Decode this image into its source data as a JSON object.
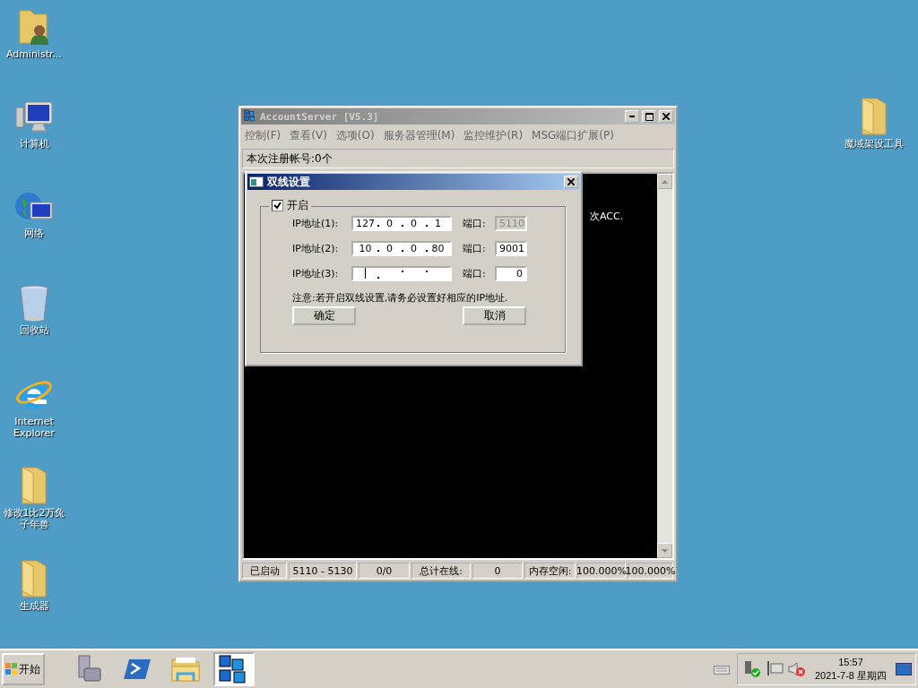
{
  "desktop_icons": [
    {
      "label": "Administr...",
      "kind": "user-folder"
    },
    {
      "label": "计算机",
      "kind": "computer"
    },
    {
      "label": "网络",
      "kind": "network"
    },
    {
      "label": "回收站",
      "kind": "recycle"
    },
    {
      "label": "Internet Explorer",
      "kind": "browser"
    },
    {
      "label": "修改1比2万兔子年兽",
      "kind": "folder"
    },
    {
      "label": "生成器",
      "kind": "folder"
    },
    {
      "label": "魔域架设工具",
      "kind": "folder"
    }
  ],
  "main_window": {
    "title": "AccountServer [V5.3]",
    "menu": [
      "控制(F)",
      "查看(V)",
      "选项(O)",
      "服务器管理(M)",
      "监控维护(R)",
      "MSG端口扩展(P)"
    ],
    "register_count": "本次注册帐号:0个",
    "console_text": "次ACC.",
    "status_bar": [
      "已启动",
      "5110 - 5130",
      "0/0",
      "总计在线:",
      "0",
      "内存空闲:",
      "100.000%",
      "100.000%"
    ]
  },
  "dialog": {
    "title": "双线设置",
    "enable": {
      "label": "开启",
      "checked": true
    },
    "rows": [
      {
        "label": "IP地址(1):",
        "ip": [
          "127",
          "0",
          "0",
          "1"
        ],
        "port_label": "端口:",
        "port": "5110",
        "disabled": true
      },
      {
        "label": "IP地址(2):",
        "ip": [
          "10",
          "0",
          "0",
          "80"
        ],
        "port_label": "端口:",
        "port": "9001",
        "disabled": false
      },
      {
        "label": "IP地址(3):",
        "port_label": "端口:",
        "port": "0",
        "disabled": false
      }
    ],
    "note": "注意:若开启双线设置,请务必设置好相应的IP地址.",
    "buttons": [
      "确定",
      "取消"
    ]
  },
  "taskbar": {
    "start": "开始",
    "apps": [
      {
        "kind": "server-manager",
        "selected": false
      },
      {
        "kind": "powershell",
        "selected": false
      },
      {
        "kind": "explorer",
        "selected": false
      },
      {
        "kind": "app",
        "selected": true
      }
    ],
    "clock": "15:57",
    "date": "2021-7-8 星期四"
  }
}
